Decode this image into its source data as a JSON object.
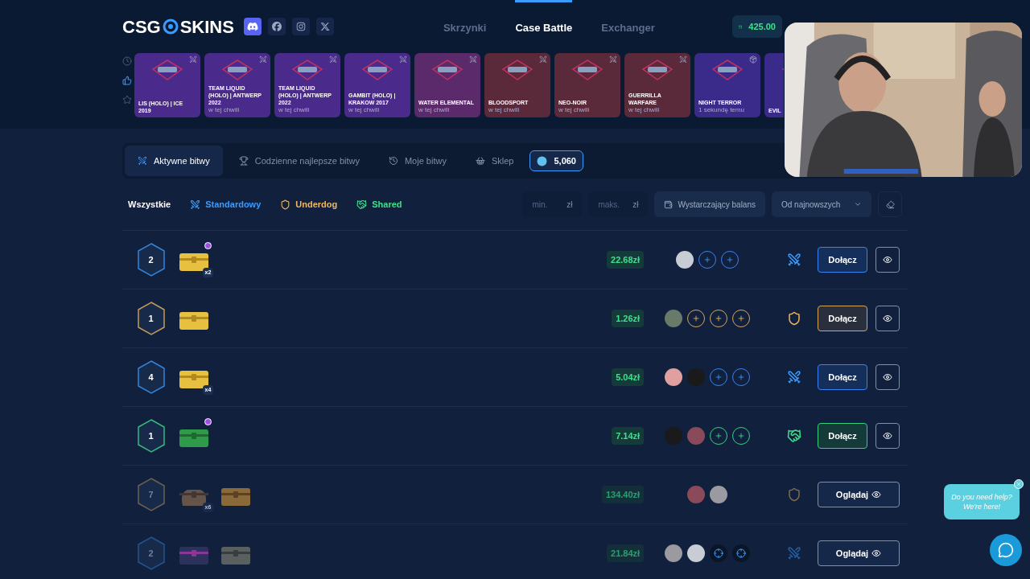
{
  "header": {
    "logo": {
      "left": "CSG",
      "right": "SKINS"
    },
    "nav": [
      {
        "label": "Skrzynki",
        "selected": false
      },
      {
        "label": "Case Battle",
        "selected": true
      },
      {
        "label": "Exchanger",
        "selected": false
      }
    ],
    "balance": "425.00"
  },
  "feed_filters": [
    {
      "kind": "recent",
      "selected": false
    },
    {
      "kind": "top",
      "selected": true
    },
    {
      "kind": "favorite",
      "selected": false
    }
  ],
  "feed": [
    {
      "name": "LIS (HOLO) | ICE 2019",
      "kind": "battle",
      "color": "#4a2a8a"
    },
    {
      "name": "TEAM LIQUID (HOLO) | ANTWERP 2022",
      "subtitle": "w tej chwili",
      "kind": "battle",
      "color": "#4a2a8a"
    },
    {
      "name": "TEAM LIQUID (HOLO) | ANTWERP 2022",
      "subtitle": "w tej chwili",
      "kind": "battle",
      "color": "#4a2a8a"
    },
    {
      "name": "GAMBIT (HOLO) | KRAKOW 2017",
      "subtitle": "w tej chwili",
      "kind": "battle",
      "color": "#4a2a8a"
    },
    {
      "name": "WATER ELEMENTAL",
      "subtitle": "w tej chwili",
      "kind": "battle",
      "color": "#5a2a6a"
    },
    {
      "name": "BLOODSPORT",
      "subtitle": "w tej chwili",
      "kind": "battle",
      "color": "#5a2a3a"
    },
    {
      "name": "NEO-NOIR",
      "subtitle": "w tej chwili",
      "kind": "battle",
      "color": "#5a2a3a"
    },
    {
      "name": "GUERRILLA WARFARE",
      "subtitle": "w tej chwili",
      "kind": "battle",
      "color": "#5a2a3a"
    },
    {
      "name": "NIGHT TERROR",
      "subtitle": "1 sekundę temu",
      "kind": "case",
      "color": "#3a2a8a"
    },
    {
      "name": "EVIL",
      "color": "#3a2a8a"
    }
  ],
  "tabs": [
    {
      "label": "Aktywne bitwy",
      "kind": "swords",
      "selected": true
    },
    {
      "label": "Codzienne najlepsze bitwy",
      "kind": "trophy",
      "selected": false
    },
    {
      "label": "Moje bitwy",
      "kind": "history",
      "selected": false
    },
    {
      "label": "Sklep",
      "kind": "shop",
      "selected": false
    }
  ],
  "coins": "5,060",
  "mode_filters": [
    {
      "label": "Wszystkie",
      "kind": "all"
    },
    {
      "label": "Standardowy",
      "kind": "standard"
    },
    {
      "label": "Underdog",
      "kind": "underdog"
    },
    {
      "label": "Shared",
      "kind": "shared"
    }
  ],
  "price_min": {
    "placeholder": "min.",
    "unit": "zł"
  },
  "price_max": {
    "placeholder": "maks.",
    "unit": "zł"
  },
  "balance_filter": "Wystarczający balans",
  "sort": "Od najnowszych",
  "battles": [
    {
      "rounds": "2",
      "kind": "standard",
      "cases": [
        {
          "kind": "gold",
          "count": "x2",
          "premium": true
        }
      ],
      "price": "22.68zł",
      "players": [
        {
          "kind": "avatar"
        },
        {
          "kind": "slot"
        },
        {
          "kind": "slot"
        }
      ],
      "button": {
        "label": "Dołącz",
        "kind": "join"
      }
    },
    {
      "rounds": "1",
      "kind": "underdog",
      "cases": [
        {
          "kind": "gold"
        }
      ],
      "price": "1.26zł",
      "players": [
        {
          "kind": "avatar"
        },
        {
          "kind": "slot"
        },
        {
          "kind": "slot"
        },
        {
          "kind": "slot"
        }
      ],
      "button": {
        "label": "Dołącz",
        "kind": "join"
      }
    },
    {
      "rounds": "4",
      "kind": "standard",
      "cases": [
        {
          "kind": "gold",
          "count": "x4"
        }
      ],
      "price": "5.04zł",
      "players": [
        {
          "kind": "avatar"
        },
        {
          "kind": "avatar"
        },
        {
          "kind": "slot"
        },
        {
          "kind": "slot"
        }
      ],
      "button": {
        "label": "Dołącz",
        "kind": "join"
      }
    },
    {
      "rounds": "1",
      "kind": "shared",
      "cases": [
        {
          "kind": "green",
          "premium": true
        }
      ],
      "price": "7.14zł",
      "players": [
        {
          "kind": "avatar"
        },
        {
          "kind": "avatar"
        },
        {
          "kind": "slot"
        },
        {
          "kind": "slot"
        }
      ],
      "button": {
        "label": "Dołącz",
        "kind": "join"
      }
    },
    {
      "rounds": "7",
      "kind": "underdog",
      "cases": [
        {
          "kind": "sack",
          "count": "x6"
        },
        {
          "kind": "chest"
        }
      ],
      "price": "134.40zł",
      "players": [
        {
          "kind": "avatar"
        },
        {
          "kind": "avatar"
        }
      ],
      "button": {
        "label": "Oglądaj",
        "kind": "watch"
      }
    },
    {
      "rounds": "2",
      "kind": "standard",
      "cases": [
        {
          "kind": "neon"
        },
        {
          "kind": "crate"
        }
      ],
      "price": "21.84zł",
      "players": [
        {
          "kind": "avatar"
        },
        {
          "kind": "avatar"
        },
        {
          "kind": "bot"
        },
        {
          "kind": "bot"
        }
      ],
      "button": {
        "label": "Oglądaj",
        "kind": "watch"
      }
    }
  ],
  "help": {
    "text": "Do you need help? We're here!"
  }
}
